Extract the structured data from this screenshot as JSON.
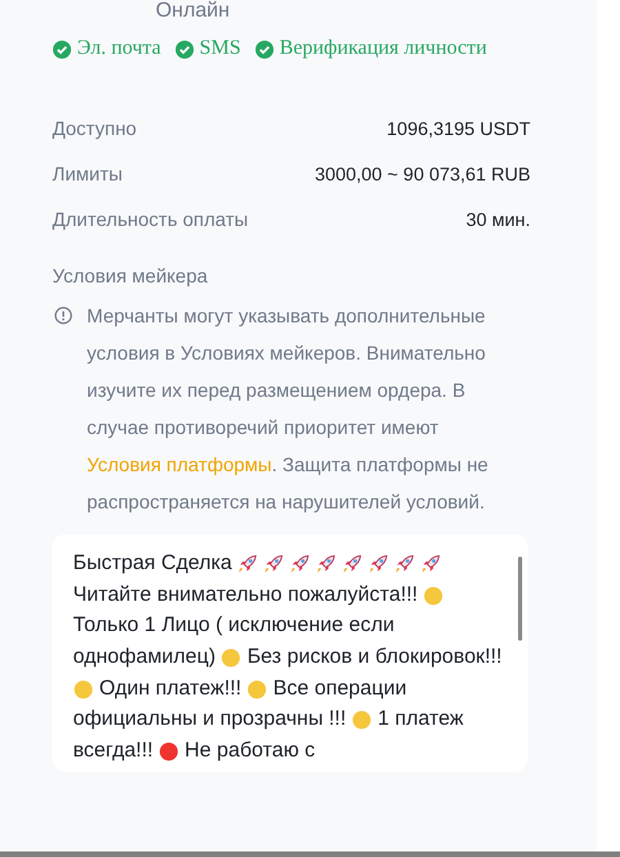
{
  "status_text": "Онлайн",
  "verifications": [
    {
      "label": "Эл. почта",
      "verified": true
    },
    {
      "label": "SMS",
      "verified": true
    },
    {
      "label": "Верификация личности",
      "verified": true
    }
  ],
  "details": [
    {
      "label": "Доступно",
      "value": "1096,3195 USDT"
    },
    {
      "label": "Лимиты",
      "value": "3000,00 ~ 90 073,61 RUB"
    },
    {
      "label": "Длительность оплаты",
      "value": "30 мин."
    }
  ],
  "terms_heading": "Условия мейкера",
  "notice": {
    "before": "Мерчанты могут указывать дополнительные условия в Условиях мейкеров. Внимательно изучите их перед размещением ордера. В случае противоречий приоритет имеют ",
    "link": "Условия платформы",
    "after": ". Защита платформы не распространяется на нарушителей условий."
  },
  "maker_terms": [
    {
      "segments": [
        {
          "kind": "text",
          "text": "Быстрая Сделка"
        },
        {
          "kind": "rocket"
        },
        {
          "kind": "rocket"
        },
        {
          "kind": "rocket"
        },
        {
          "kind": "rocket"
        },
        {
          "kind": "rocket"
        },
        {
          "kind": "rocket"
        },
        {
          "kind": "rocket"
        },
        {
          "kind": "rocket"
        }
      ]
    },
    {
      "segments": [
        {
          "kind": "text",
          "text": "Читайте внимательно пожалуйста!!!"
        },
        {
          "kind": "dot",
          "color": "#f5c73d"
        }
      ]
    },
    {
      "segments": [
        {
          "kind": "text",
          "text": "Только 1 Лицо ( исключение если"
        }
      ]
    },
    {
      "segments": [
        {
          "kind": "text",
          "text": "однофамилец)"
        },
        {
          "kind": "dot",
          "color": "#f5c73d"
        },
        {
          "kind": "text",
          "text": "Без рисков и блокировок!!!"
        }
      ]
    },
    {
      "segments": [
        {
          "kind": "dot",
          "color": "#f5c73d"
        },
        {
          "kind": "text",
          "text": "Один платеж!!!"
        },
        {
          "kind": "dot",
          "color": "#f5c73d"
        },
        {
          "kind": "text",
          "text": "Все операции"
        }
      ]
    },
    {
      "segments": [
        {
          "kind": "text",
          "text": "официальны и прозрачны !!!"
        },
        {
          "kind": "dot",
          "color": "#f5c73d"
        },
        {
          "kind": "text",
          "text": "1 платеж"
        }
      ]
    },
    {
      "segments": [
        {
          "kind": "text",
          "text": "всегда!!!"
        },
        {
          "kind": "dot",
          "color": "#f0332f"
        },
        {
          "kind": "text",
          "text": "Не работаю с"
        }
      ]
    }
  ]
}
